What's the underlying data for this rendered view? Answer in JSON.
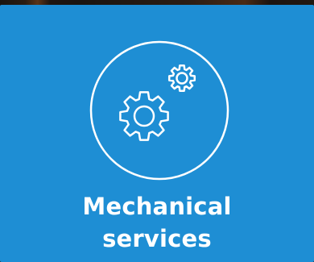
{
  "card": {
    "title_line1": "Mechanical",
    "title_line2": "services",
    "icon": "gears-icon",
    "background_color": "#1e8ed4",
    "text_color": "#ffffff"
  }
}
